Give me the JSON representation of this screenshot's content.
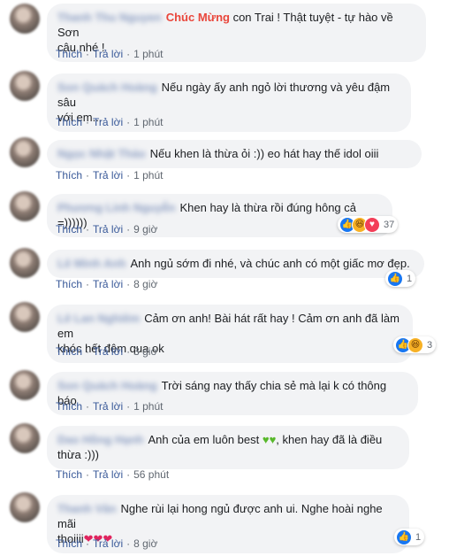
{
  "comments": [
    {
      "author": "Thanh Thu Nguyen",
      "congrats": "Chúc Mừng",
      "line1": " con Trai ! Thật tuyệt - tự hào về Sơn",
      "line2": "cậu nhé !",
      "time": "1 phút"
    },
    {
      "author": "Son Quách Hoàng",
      "line1": "Nếu ngày ấy anh ngỏ lời thương và yêu đậm sâu",
      "line2": "với em...",
      "time": "1 phút"
    },
    {
      "author": "Ngọc Nhật Thảo",
      "line1": "Nếu khen là thừa ỏi :)) eo hát hay thế idol oiii",
      "time": "1 phút"
    },
    {
      "author": "Phương Linh Nguyễn",
      "line1": "Khen hay là thừa rồi đúng hông cả =))))))",
      "time": "9 giờ",
      "reactions": "37"
    },
    {
      "author": "Lê Minh Anh",
      "line1": "Anh ngủ sớm đi nhé, và chúc anh có một giấc mơ đẹp.",
      "time": "8 giờ",
      "reactions": "1"
    },
    {
      "author": "Lê Lan Nghiêm",
      "line1": "Cảm ơn anh! Bài hát rất hay ! Cảm ơn anh đã làm em",
      "line2": "khóc hết đêm qua ok",
      "time": "3 giờ",
      "reactions": "3"
    },
    {
      "author": "Son Quách Hoàng",
      "line1": "Trời sáng nay thấy chia sẻ mà lại k có thông báo",
      "time": "1 phút"
    },
    {
      "author": "Dao Hồng Hạnh",
      "line1": "Anh của em luôn best ",
      "line1b": ", khen hay đã là điều",
      "line2": "thừa :)))",
      "time": "56 phút"
    },
    {
      "author": "Thanh Vân",
      "line1": "Nghe rùi lại hong ngủ được anh ui. Nghe hoài nghe mãi",
      "line2": "thoiiii",
      "time": "8 giờ",
      "reactions": "1"
    }
  ],
  "labels": {
    "like": "Thích",
    "reply": "Trả lời",
    "dot": "·"
  },
  "icons": {
    "like": "like-icon",
    "haha": "haha-icon",
    "love": "love-icon",
    "green_heart": "green-heart-icon",
    "heart_eyes": "heart-eyes-icon"
  }
}
